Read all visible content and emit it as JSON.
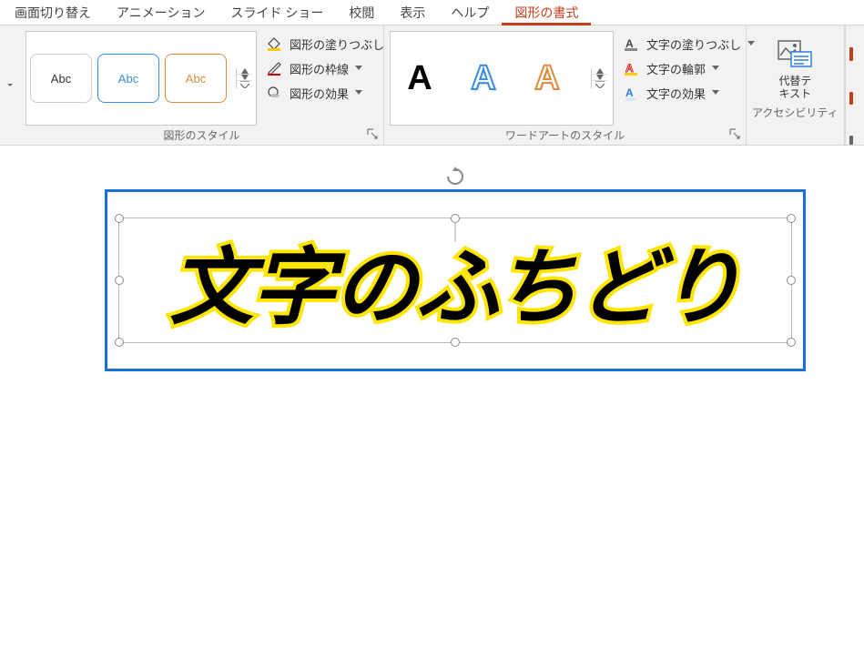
{
  "menu": {
    "transition": "画面切り替え",
    "animation": "アニメーション",
    "slideshow": "スライド ショー",
    "review": "校閲",
    "view": "表示",
    "help": "ヘルプ",
    "shape_format": "図形の書式"
  },
  "shape_gallery": {
    "item1": "Abc",
    "item2": "Abc",
    "item3": "Abc"
  },
  "shape_opts": {
    "fill": "図形の塗りつぶし",
    "outline": "図形の枠線",
    "effects": "図形の効果"
  },
  "groups": {
    "shape_styles": "図形のスタイル",
    "wordart_styles": "ワードアートのスタイル",
    "accessibility": "アクセシビリティ"
  },
  "wordart_items": {
    "a1": "A",
    "a2": "A",
    "a3": "A"
  },
  "text_opts": {
    "fill": "文字の塗りつぶし",
    "outline": "文字の輪郭",
    "effects": "文字の効果"
  },
  "alt_text": {
    "line1": "代替テ",
    "line2": "キスト"
  },
  "canvas_text": "文字のふちどり"
}
